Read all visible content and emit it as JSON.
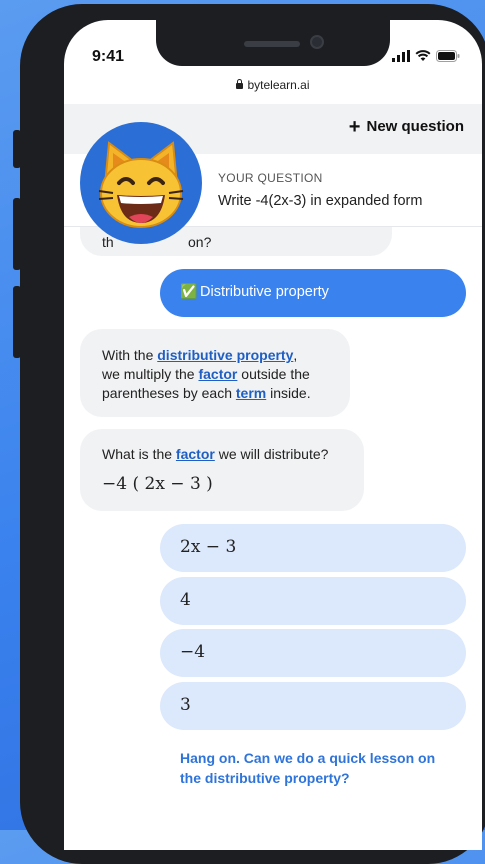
{
  "status": {
    "time": "9:41",
    "url": "bytelearn.ai"
  },
  "header": {
    "new_question_label": "New question"
  },
  "question": {
    "label": "YOUR QUESTION",
    "text": "Write -4(2x-3) in expanded form"
  },
  "chat": {
    "partial_prev": "on?",
    "selected_answer": {
      "check": "✅",
      "text": "Distributive property"
    },
    "explanation": {
      "p1": "With the ",
      "link1": "distributive property",
      "p2": ",",
      "p3": "we multiply the ",
      "link2": "factor",
      "p4": " outside the",
      "p5": "parentheses by each ",
      "link3": "term",
      "p6": " inside."
    },
    "prompt": {
      "p1": "What is the ",
      "link": "factor",
      "p2": " we will distribute?",
      "expression": "−4 ( 2x − 3 )"
    },
    "answers": [
      "2x − 3",
      "4",
      "−4",
      "3"
    ],
    "lesson_link": "Hang on. Can we do a quick lesson on the distributive property?"
  },
  "colors": {
    "accent": "#3a82ee",
    "answer_bg": "#dce8fb",
    "link": "#1f5fc4"
  },
  "icons": {
    "avatar": "grinning-cat-emoji",
    "plus": "plus-icon",
    "lock": "lock-icon"
  }
}
